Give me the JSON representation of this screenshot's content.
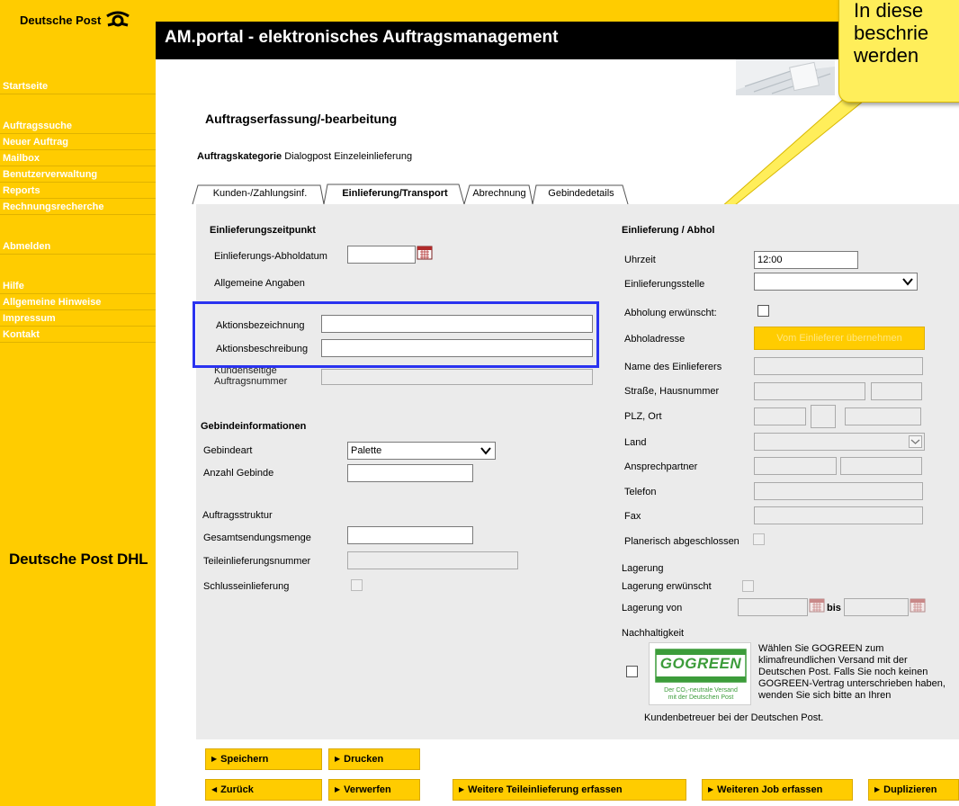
{
  "sidebar": {
    "brand": "Deutsche Post",
    "items": [
      "Startseite",
      "Auftragssuche",
      "Neuer Auftrag",
      "Mailbox",
      "Benutzerverwaltung",
      "Reports",
      "Rechnungsrecherche",
      "Abmelden",
      "Hilfe",
      "Allgemeine Hinweise",
      "Impressum",
      "Kontakt"
    ],
    "footer_brand": "Deutsche Post DHL"
  },
  "header": {
    "title": "AM.portal - elektronisches Auftragsmanagement"
  },
  "callout": {
    "lines": [
      "In diese",
      "beschrie",
      "werden"
    ]
  },
  "page": {
    "title": "Auftragserfassung/-bearbeitung",
    "category_label": "Auftragskategorie",
    "category_value": "Dialogpost Einzeleinlieferung"
  },
  "tabs": [
    "Kunden-/Zahlungsinf.",
    "Einlieferung/Transport",
    "Abrechnung",
    "Gebindedetails"
  ],
  "left": {
    "section_zeitpunkt": "Einlieferungszeitpunkt",
    "abholdatum_label": "Einlieferungs-Abholdatum",
    "abholdatum_value": "",
    "allgemeine_angaben": "Allgemeine Angaben",
    "aktionsbezeichnung_label": "Aktionsbezeichnung",
    "aktionsbezeichnung_value": "",
    "aktionsbeschreibung_label": "Aktionsbeschreibung",
    "aktionsbeschreibung_value": "",
    "kundenauftrag_label_1": "Kundenseitige",
    "kundenauftrag_label_2": "Auftragsnummer",
    "section_gebinde": "Gebindeinformationen",
    "gebindeart_label": "Gebindeart",
    "gebindeart_value": "Palette",
    "anzahl_label": "Anzahl Gebinde",
    "anzahl_value": "",
    "auftragsstruktur": "Auftragsstruktur",
    "gesamt_label": "Gesamtsendungsmenge",
    "gesamt_value": "",
    "teil_label": "Teileinlieferungsnummer",
    "schluss_label": "Schlusseinlieferung"
  },
  "right": {
    "section": "Einlieferung / Abhol",
    "uhrzeit_label": "Uhrzeit",
    "uhrzeit_value": "12:00",
    "stelle_label": "Einlieferungsstelle",
    "abholung_label": "Abholung erwünscht:",
    "abholadresse_label": "Abholadresse",
    "uebernehmen_label": "Vom Einlieferer übernehmen",
    "name_label": "Name des Einlieferers",
    "strasse_label": "Straße, Hausnummer",
    "plz_label": "PLZ, Ort",
    "land_label": "Land",
    "ansprech_label": "Ansprechpartner",
    "telefon_label": "Telefon",
    "fax_label": "Fax",
    "planerisch_label": "Planerisch abgeschlossen",
    "lagerung": "Lagerung",
    "lagerung_erw_label": "Lagerung erwünscht",
    "lagerung_von_label": "Lagerung von",
    "bis_label": "bis",
    "nachhaltigkeit": "Nachhaltigkeit",
    "gogreen_logo": "GOGREEN",
    "gogreen_sub_1": "Der CO₂-neutrale Versand",
    "gogreen_sub_2": "mit der Deutschen Post",
    "gogreen_text": "Wählen Sie GOGREEN zum klimafreundlichen Versand mit der Deutschen Post. Falls Sie noch keinen GOGREEN-Vertrag unterschrieben haben, wenden Sie sich bitte an Ihren",
    "gogreen_text_last": "Kundenbetreuer bei der Deutschen Post."
  },
  "buttons": {
    "speichern": "Speichern",
    "drucken": "Drucken",
    "zurueck": "Zurück",
    "verwerfen": "Verwerfen",
    "teileinlieferung": "Weitere Teileinlieferung erfassen",
    "job": "Weiteren Job erfassen",
    "duplizieren": "Duplizieren"
  },
  "colors": {
    "brand_yellow": "#ffcc00",
    "highlight_blue": "#2a33f0",
    "callout_yellow": "#ffee5a",
    "gogreen_green": "#3c9c3a"
  }
}
